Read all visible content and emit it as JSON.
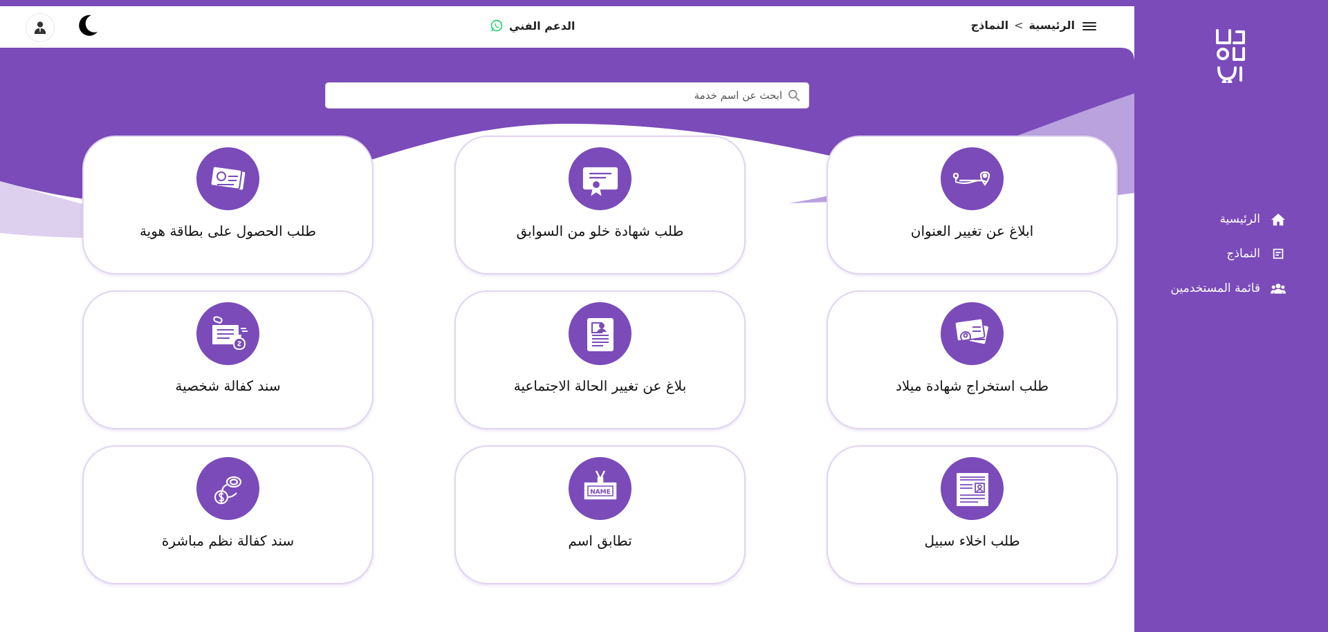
{
  "colors": {
    "brand": "#7a4bb9",
    "brand_light": "#c1a8e1",
    "whatsapp": "#25d366"
  },
  "logo": {
    "text": "خدماتي",
    "icon": "logo-mark"
  },
  "sidebar": {
    "items": [
      {
        "label": "الرئيسية",
        "icon": "home-icon"
      },
      {
        "label": "النماذج",
        "icon": "forms-icon"
      },
      {
        "label": "قائمة المستخدمين",
        "icon": "users-icon"
      }
    ]
  },
  "header": {
    "breadcrumb": {
      "home": "الرئيسية",
      "separator": ">",
      "current": "النماذج"
    },
    "support_label": "الدعم الفني"
  },
  "search": {
    "placeholder": "ابحث عن اسم خدمة"
  },
  "cards": [
    {
      "title": "ابلاغ عن تغيير العنوان",
      "icon": "address-change-icon"
    },
    {
      "title": "طلب شهادة خلو من السوابق",
      "icon": "certificate-icon"
    },
    {
      "title": "طلب الحصول على بطاقة هوية",
      "icon": "id-card-icon"
    },
    {
      "title": "طلب استخراج شهادة ميلاد",
      "icon": "birth-certificate-icon"
    },
    {
      "title": "بلاغ عن تغيير الحالة الاجتماعية",
      "icon": "document-icon"
    },
    {
      "title": "سند كفالة شخصية",
      "icon": "guarantee-icon"
    },
    {
      "title": "طلب اخلاء سبيل",
      "icon": "release-document-icon"
    },
    {
      "title": "تطابق اسم",
      "icon": "name-badge-icon"
    },
    {
      "title": "سند كفالة نظم مباشرة",
      "icon": "money-icon"
    }
  ],
  "name_badge_text": "NAME"
}
